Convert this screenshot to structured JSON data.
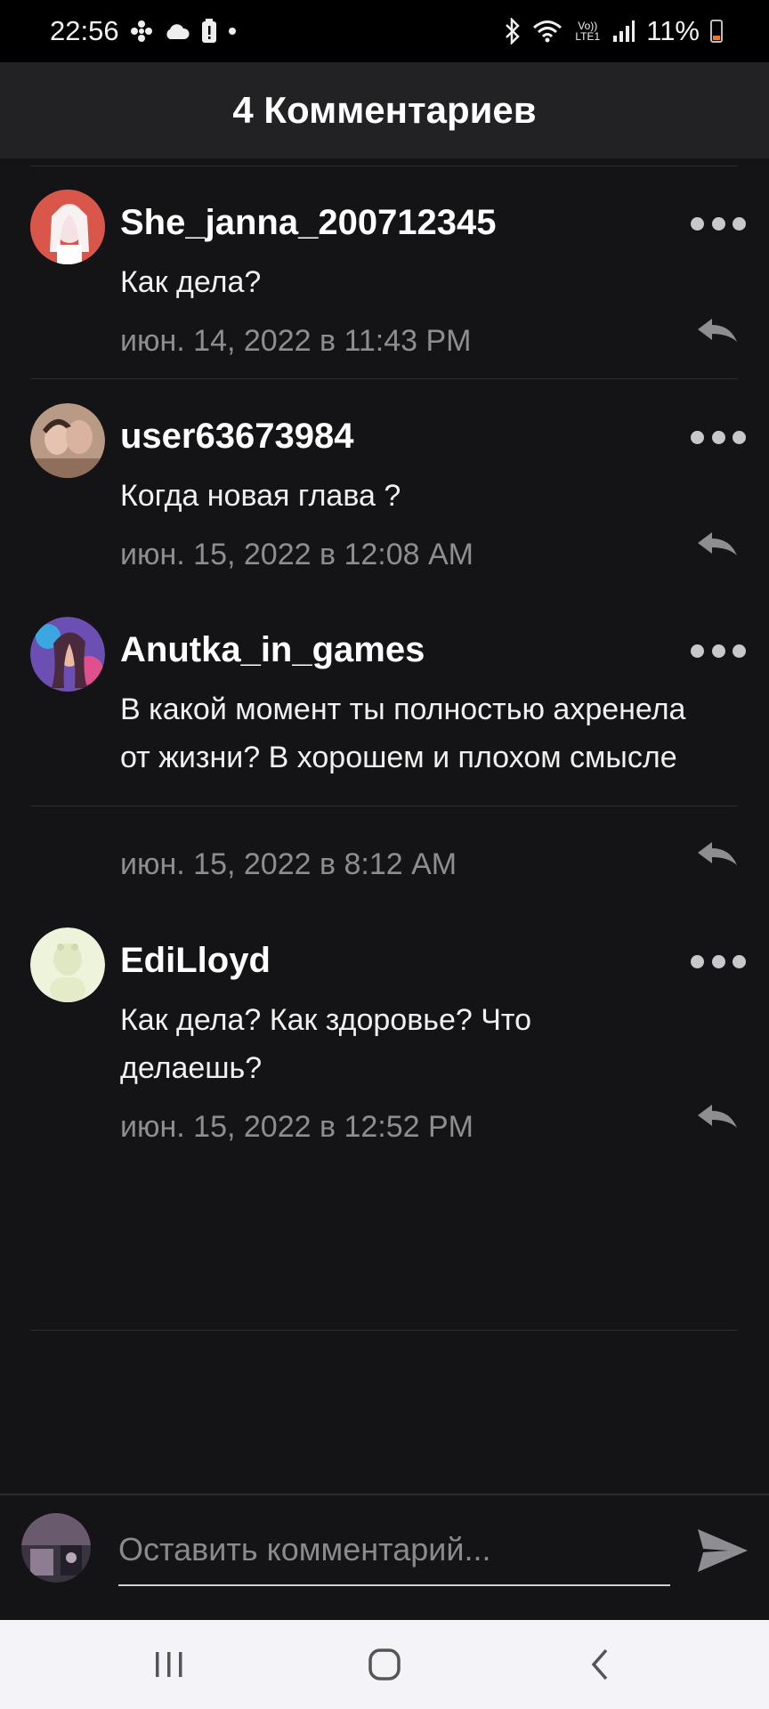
{
  "status_bar": {
    "time": "22:56",
    "battery_text": "11%",
    "icons_left": [
      "fan-icon",
      "cloud-icon",
      "alert-battery-icon",
      "dot-icon"
    ],
    "icons_right": [
      "bluetooth-icon",
      "wifi-icon",
      "volte-icon",
      "signal-icon",
      "battery-icon"
    ],
    "volte_label": "Vo)) LTE1"
  },
  "header": {
    "title": "4 Комментариев"
  },
  "comments": [
    {
      "username": "She_janna_200712345",
      "text": "Как дела?",
      "time": "июн. 14, 2022 в 11:43 PM",
      "avatar_color": "#d9574a"
    },
    {
      "username": "user63673984",
      "text": "Когда новая глава ?",
      "time": "июн. 15, 2022 в 12:08 AM",
      "avatar_color": "#b99a86"
    },
    {
      "username": "Anutka_in_games",
      "text": "В какой момент ты полностью ахренела от жизни? В хорошем и плохом смысле",
      "time": "июн. 15, 2022 в 8:12 AM",
      "avatar_color": "#6b4fb3"
    },
    {
      "username": "EdiLloyd",
      "text": "Как дела? Как здоровье? Что делаешь?",
      "time": "июн. 15, 2022 в 12:52 PM",
      "avatar_color": "#eef3dc"
    }
  ],
  "composer": {
    "placeholder": "Оставить комментарий..."
  },
  "nav": {
    "buttons": [
      "recent-apps-icon",
      "home-icon",
      "back-icon"
    ]
  },
  "colors": {
    "background": "#141316",
    "header_bg": "#222124",
    "muted_text": "#8e8d92",
    "nav_bg": "#f4f3f7"
  }
}
